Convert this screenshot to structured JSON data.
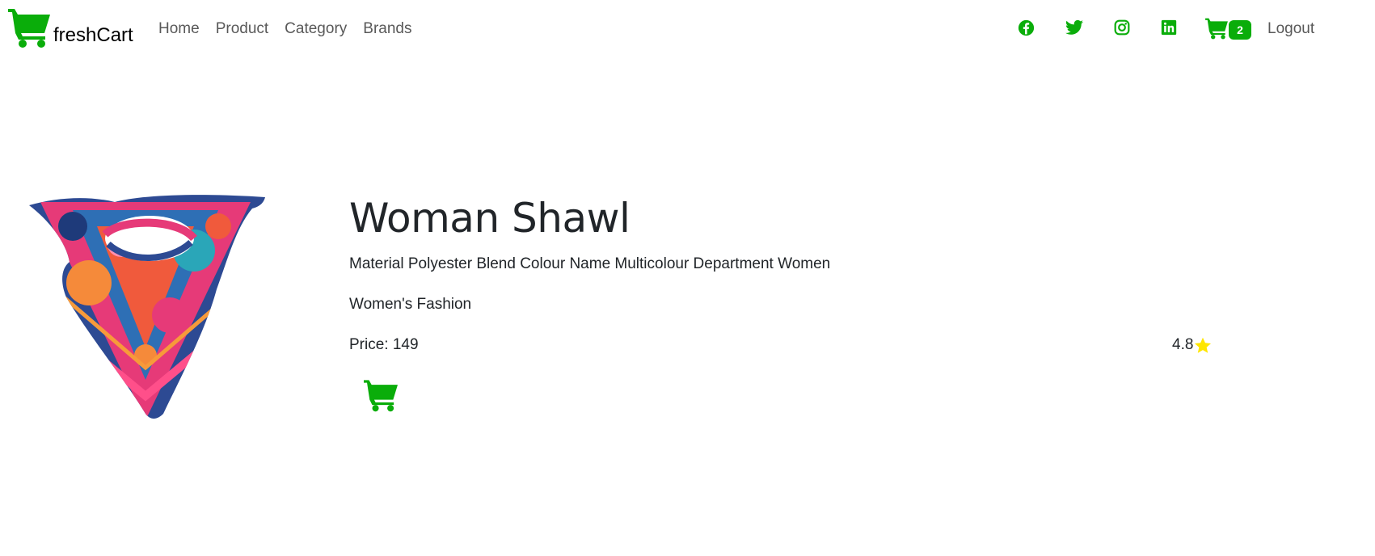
{
  "brand": {
    "name": "freshCart",
    "icon": "cart-icon"
  },
  "nav": {
    "links": [
      "Home",
      "Product",
      "Category",
      "Brands"
    ],
    "social": [
      "facebook-icon",
      "twitter-icon",
      "instagram-icon",
      "linkedin-icon"
    ],
    "cart_count": "2",
    "logout": "Logout"
  },
  "product": {
    "title": "Woman Shawl",
    "description": "Material Polyester Blend Colour Name Multicolour Department Women",
    "category": "Women's Fashion",
    "price_label": "Price: 149",
    "rating": "4.8"
  },
  "colors": {
    "accent": "#0aad0a",
    "star": "#ffe600",
    "text": "#212529",
    "nav_text": "#595959"
  }
}
